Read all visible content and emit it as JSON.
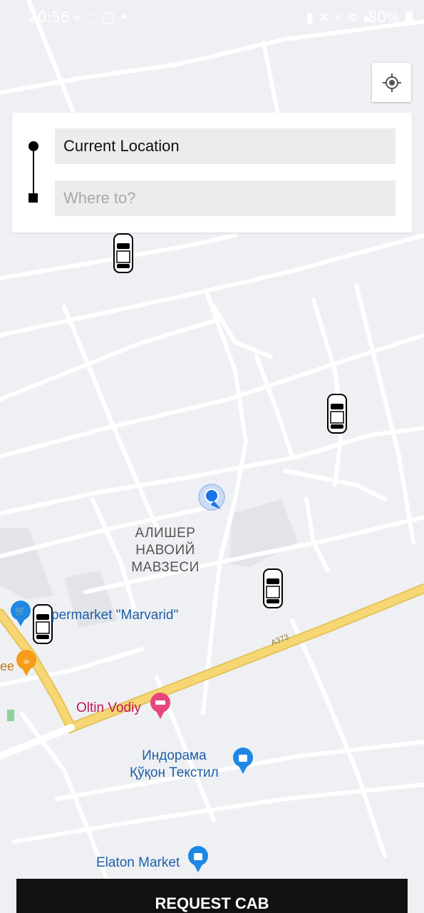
{
  "status_bar": {
    "time": "20:56",
    "battery_percent": "80%",
    "left_icons": [
      "location-icon",
      "whatsapp-icon",
      "instagram-icon",
      "dot-icon"
    ],
    "right_icons": [
      "battery-saver-icon",
      "mute-icon",
      "location-icon",
      "wifi-icon",
      "signal-icon",
      "battery-icon"
    ]
  },
  "locate_button": {
    "icon": "my-location-icon"
  },
  "route": {
    "pickup": {
      "value": "Current Location"
    },
    "dropoff": {
      "placeholder": "Where to?",
      "value": ""
    }
  },
  "map": {
    "district_label_lines": [
      "АЛИШЕР",
      "НАВОИЙ",
      "МАВЗЕСИ"
    ],
    "road_label": "A373",
    "pois": [
      {
        "name": "permarket \"Marvarid\"",
        "icon": "shopping-cart-icon",
        "color": "#1e88e5"
      },
      {
        "name": "ee",
        "icon": "coffee-icon",
        "color": "#f59c1a"
      },
      {
        "name": "Oltin Vodiy",
        "icon": "hotel-bed-icon",
        "color": "#e8467c"
      },
      {
        "name_lines": [
          "Индорама",
          "Қўқон Текстил"
        ],
        "icon": "shopping-bag-icon",
        "color": "#1e88e5"
      },
      {
        "name": "Elaton Market",
        "icon": "shopping-bag-icon",
        "color": "#1e88e5"
      }
    ],
    "taxi_icon": "taxi-car-icon",
    "user_marker_icon": "user-location-marker-icon"
  },
  "request_button": {
    "label": "REQUEST CAB"
  },
  "colors": {
    "map_background": "#eef0f3",
    "road_main": "#f7d774",
    "road_minor": "#ffffff",
    "user_dot": "#1a73e8",
    "button": "#111111"
  }
}
